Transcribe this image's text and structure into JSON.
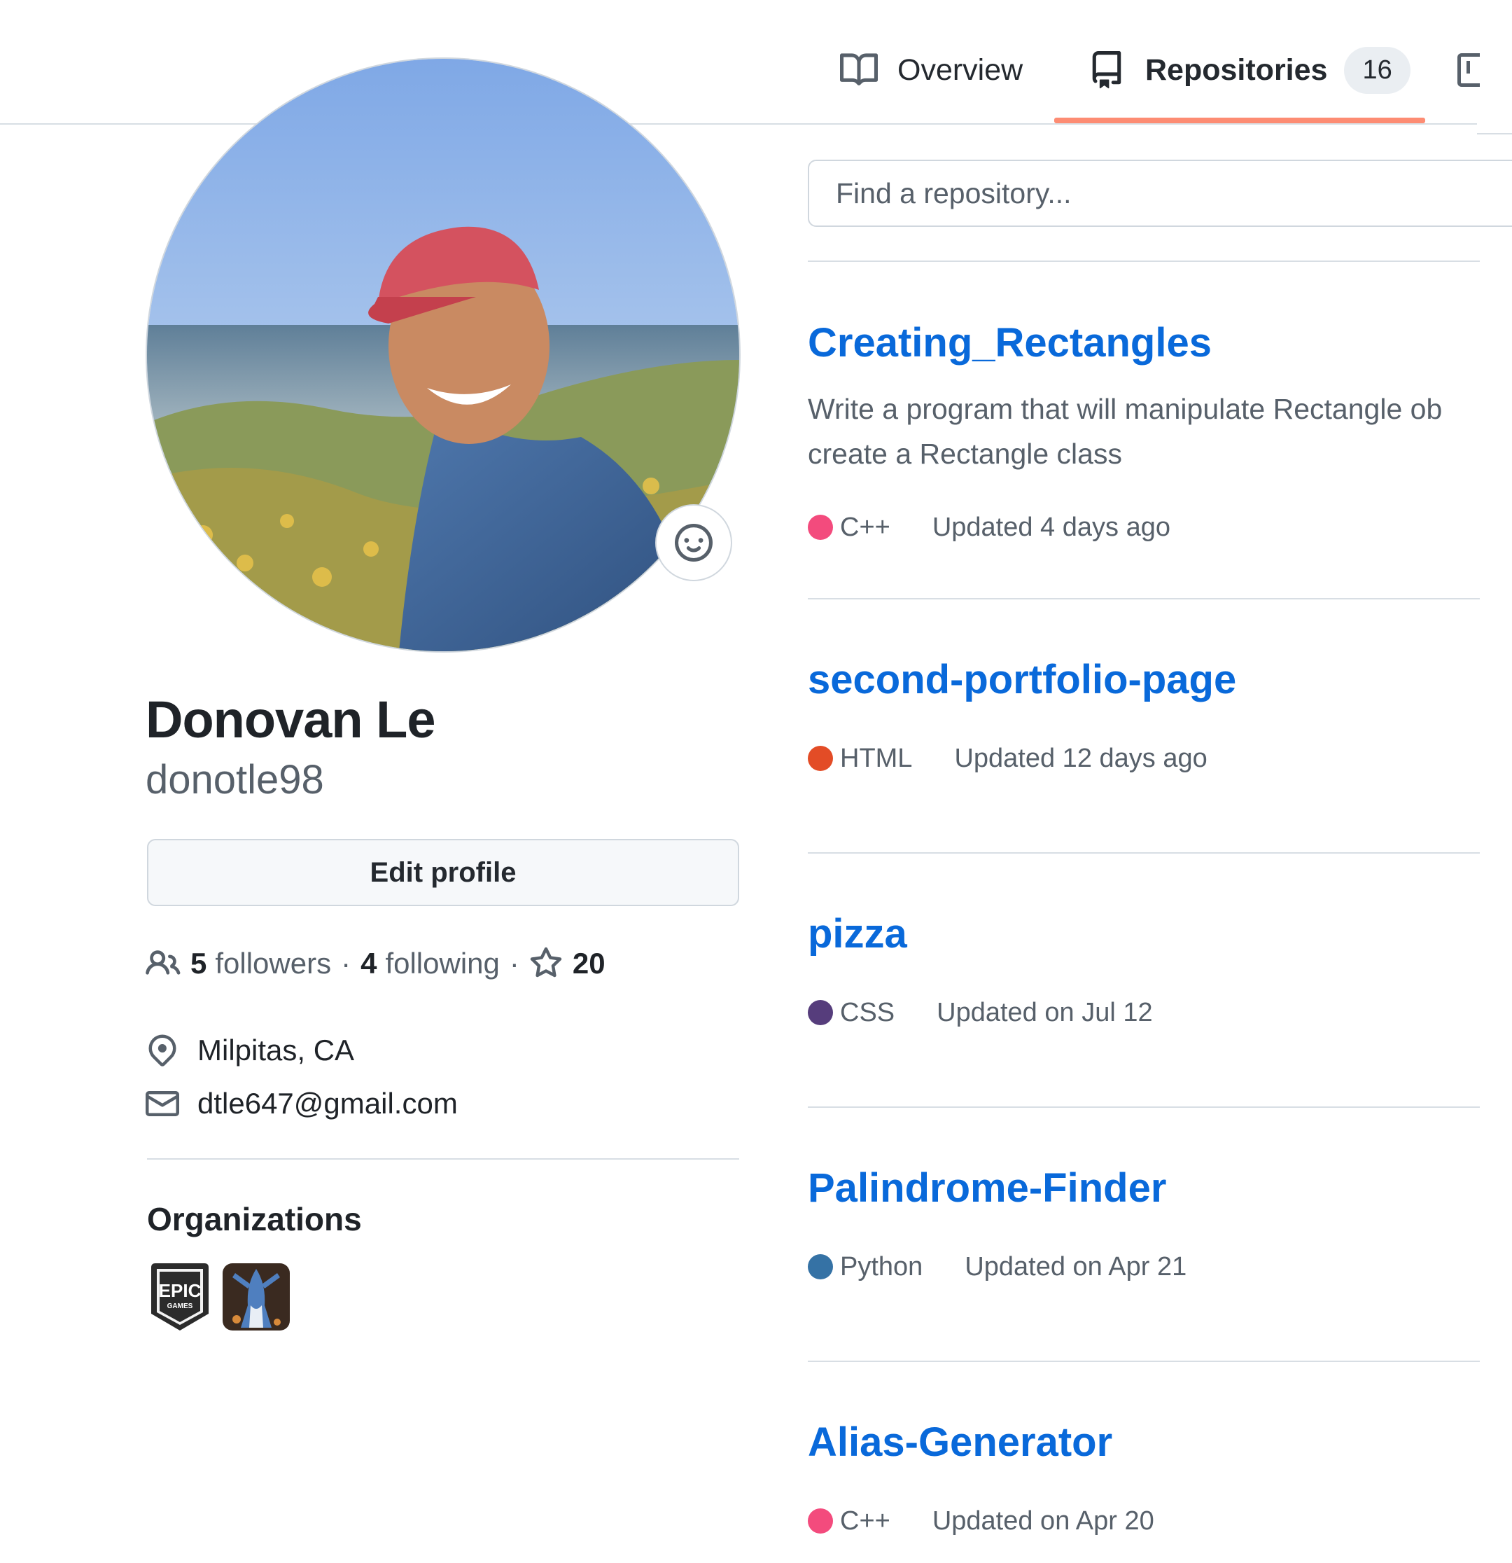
{
  "tabs": {
    "overview": "Overview",
    "repositories": "Repositories",
    "repositories_count": "16"
  },
  "profile": {
    "full_name": "Donovan Le",
    "username": "donotle98",
    "edit_button": "Edit profile",
    "followers_count": "5",
    "followers_label": "followers",
    "following_count": "4",
    "following_label": "following",
    "stars_count": "20",
    "location": "Milpitas, CA",
    "email": "dtle647@gmail.com"
  },
  "organizations": {
    "title": "Organizations",
    "epic_logo_text": "EPIC",
    "epic_logo_sub": "GAMES"
  },
  "search": {
    "placeholder": "Find a repository..."
  },
  "repos": [
    {
      "name": "Creating_Rectangles",
      "description_line1": "Write a program that will manipulate Rectangle ob",
      "description_line2": "create a Rectangle class",
      "language": "C++",
      "language_color": "#f34b7d",
      "updated": "Updated 4 days ago"
    },
    {
      "name": "second-portfolio-page",
      "language": "HTML",
      "language_color": "#e34c26",
      "updated": "Updated 12 days ago"
    },
    {
      "name": "pizza",
      "language": "CSS",
      "language_color": "#563d7c",
      "updated": "Updated on Jul 12"
    },
    {
      "name": "Palindrome-Finder",
      "language": "Python",
      "language_color": "#3572A5",
      "updated": "Updated on Apr 21"
    },
    {
      "name": "Alias-Generator",
      "language": "C++",
      "language_color": "#f34b7d",
      "updated": "Updated on Apr 20"
    }
  ],
  "icons": {
    "overview": "book-icon",
    "repositories": "repo-icon",
    "projects": "project-icon",
    "avatar_status": "smiley-icon",
    "followers": "people-icon",
    "stars": "star-icon",
    "location": "location-icon",
    "email": "mail-icon"
  }
}
